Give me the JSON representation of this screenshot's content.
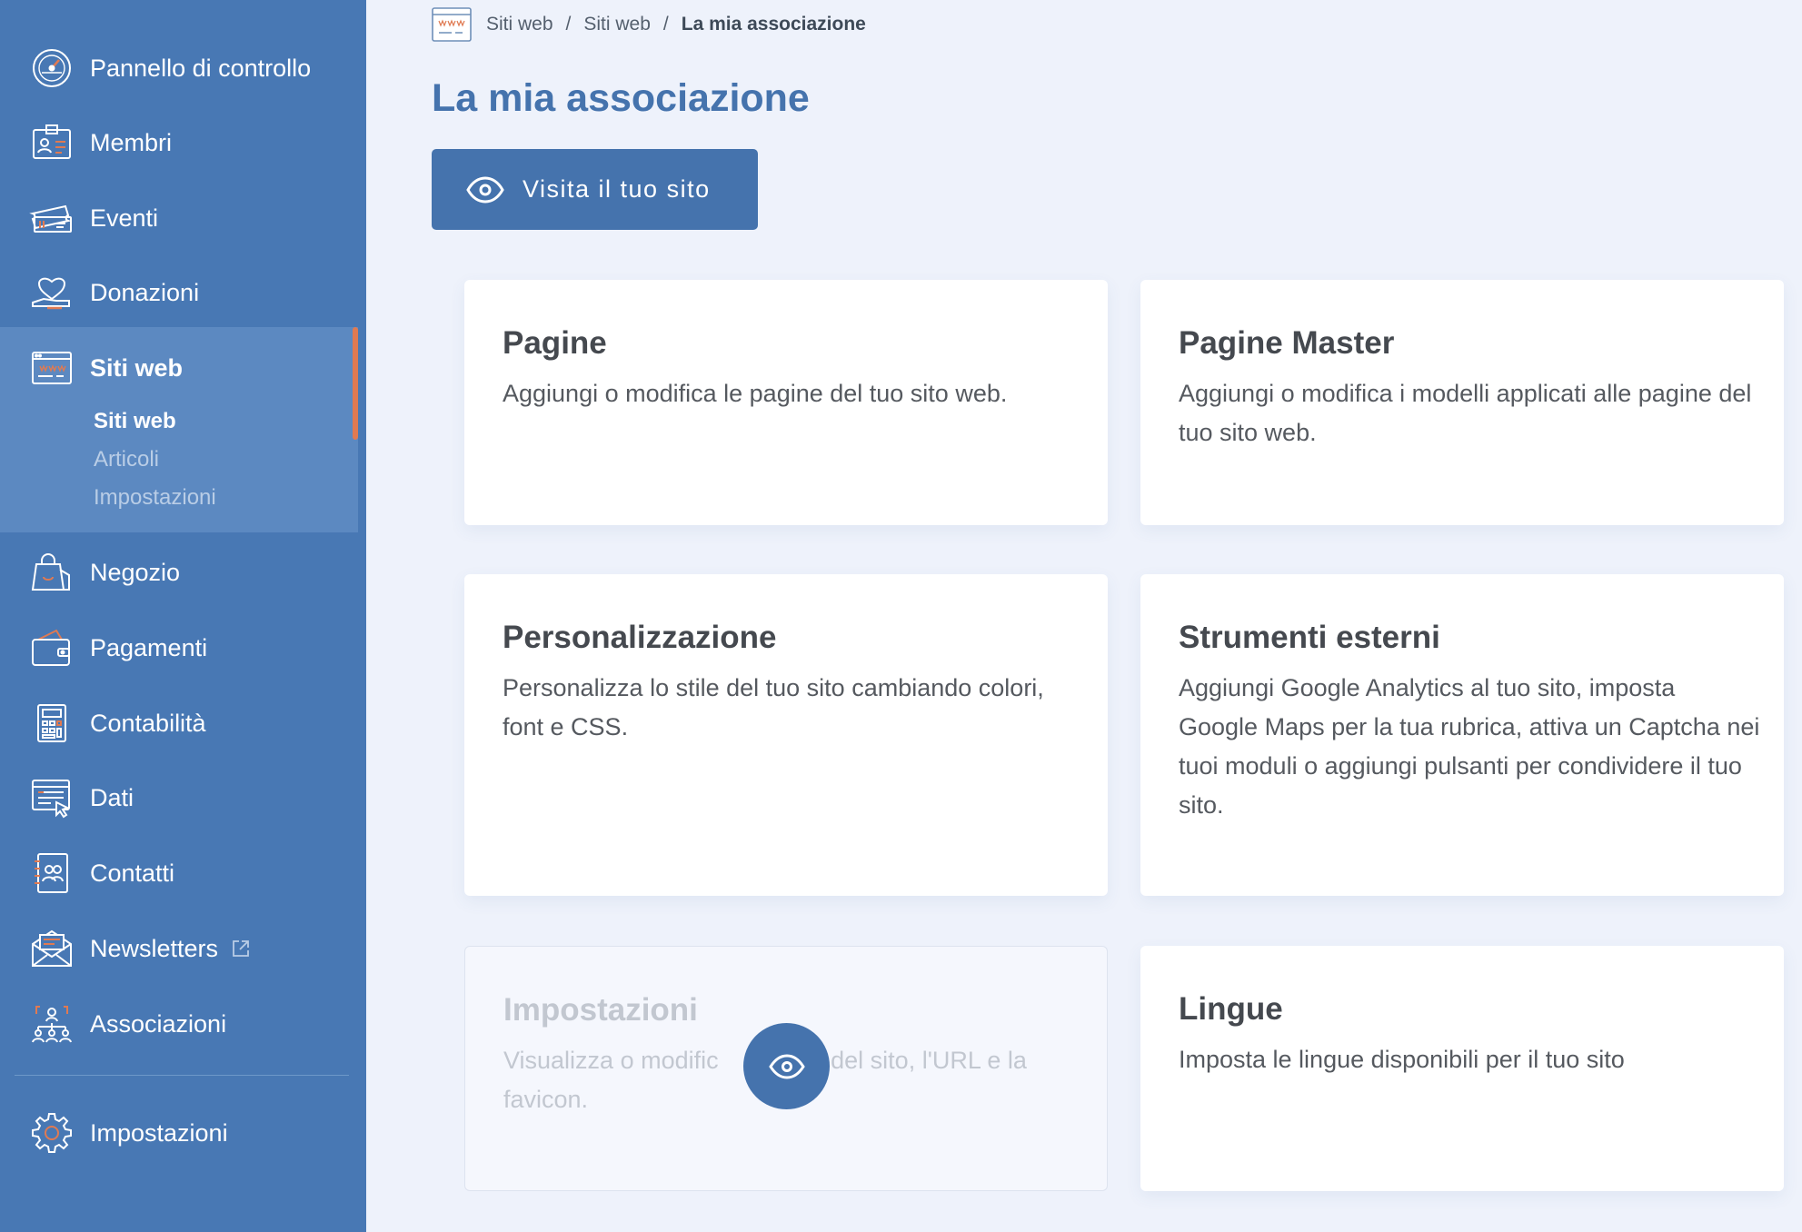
{
  "sidebar": {
    "items": [
      {
        "label": "Pannello di controllo",
        "icon": "dashboard-gauge-icon"
      },
      {
        "label": "Membri",
        "icon": "member-card-icon"
      },
      {
        "label": "Eventi",
        "icon": "event-tickets-icon"
      },
      {
        "label": "Donazioni",
        "icon": "heart-hand-icon"
      },
      {
        "label": "Siti web",
        "icon": "website-window-icon"
      },
      {
        "label": "Negozio",
        "icon": "shopping-bag-icon"
      },
      {
        "label": "Pagamenti",
        "icon": "wallet-icon"
      },
      {
        "label": "Contabilità",
        "icon": "calculator-icon"
      },
      {
        "label": "Dati",
        "icon": "data-window-cursor-icon"
      },
      {
        "label": "Contatti",
        "icon": "address-book-icon"
      },
      {
        "label": "Newsletters",
        "icon": "envelope-icon"
      },
      {
        "label": "Associazioni",
        "icon": "organization-chart-icon"
      },
      {
        "label": "Impostazioni",
        "icon": "gear-icon"
      }
    ],
    "subnav": [
      "Siti web",
      "Articoli",
      "Impostazioni"
    ],
    "active_accent": "#e07a52",
    "background": "#4878b4"
  },
  "breadcrumb": [
    "Siti web",
    "Siti web",
    "La mia associazione"
  ],
  "page_title": "La mia associazione",
  "visit_button": "Visita il tuo sito",
  "cards": [
    {
      "title": "Pagine",
      "description": "Aggiungi o modifica le pagine del tuo sito web."
    },
    {
      "title": "Pagine Master",
      "description": "Aggiungi o modifica i modelli applicati alle pagine del tuo sito web."
    },
    {
      "title": "Personalizzazione",
      "description": "Personalizza lo stile del tuo sito cambiando colori, font e CSS."
    },
    {
      "title": "Strumenti esterni",
      "description": "Aggiungi Google Analytics al tuo sito, imposta Google Maps per la tua rubrica, attiva un Captcha nei tuoi moduli o aggiungi pulsanti per condividere il tuo sito."
    },
    {
      "title": "Impostazioni",
      "description_start": "Visualizza o modific",
      "description_end": "ne del sito, l'URL e la favicon."
    },
    {
      "title": "Lingue",
      "description": "Imposta le lingue disponibili per il tuo sito"
    }
  ],
  "accent_color": "#4573ad"
}
